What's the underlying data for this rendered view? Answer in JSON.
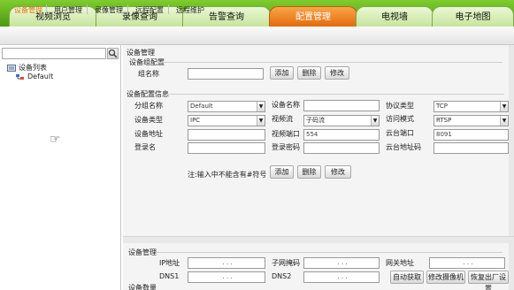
{
  "tabs": [
    {
      "label": "视频浏览"
    },
    {
      "label": "录像查询"
    },
    {
      "label": "告警查询"
    },
    {
      "label": "配置管理"
    },
    {
      "label": "电视墙"
    },
    {
      "label": "电子地图"
    }
  ],
  "submenu": [
    {
      "label": "设备管理"
    },
    {
      "label": "用户管理"
    },
    {
      "label": "录像管理"
    },
    {
      "label": "远程配置"
    },
    {
      "label": "远程维护"
    }
  ],
  "sidebar": {
    "tree_root": "设备列表",
    "tree_child": "Default"
  },
  "device_manage": {
    "title": "设备管理",
    "group_config": {
      "title": "设备组配置",
      "group_name_label": "组名称",
      "group_name_value": "",
      "add": "添加",
      "delete": "删除",
      "modify": "修改"
    },
    "config_info": {
      "title": "设备配置信息",
      "group_label": "分组名称",
      "group_value": "Default",
      "device_name_label": "设备名称",
      "device_name_value": "",
      "protocol_label": "协议类型",
      "protocol_value": "TCP",
      "device_type_label": "设备类型",
      "device_type_value": "IPC",
      "stream_label": "视频流",
      "stream_value": "子码流",
      "access_mode_label": "访问模式",
      "access_mode_value": "RTSP",
      "address_label": "设备地址",
      "address_value": "",
      "video_port_label": "视频端口",
      "video_port_value": "554",
      "ptz_port_label": "云台端口",
      "ptz_port_value": "8091",
      "login_name_label": "登录名",
      "login_name_value": "",
      "login_pwd_label": "登录密码",
      "login_pwd_value": "",
      "ptz_addr_label": "云台地址码",
      "ptz_addr_value": "",
      "note": "注:输入中不能含有#符号",
      "add": "添加",
      "delete": "删除",
      "modify": "修改"
    }
  },
  "bottom": {
    "title": "设备管理",
    "ip_label": "IP地址",
    "subnet_label": "子网掩码",
    "gateway_label": "网关地址",
    "dns1_label": "DNS1",
    "dns2_label": "DNS2",
    "ip_dots": ".   .   .",
    "auto_get": "自动获取",
    "modify_camera": "修改摄像机",
    "factory_reset": "恢复出厂设置",
    "device_count_label": "设备数量"
  },
  "colors": {
    "topbar": "#5aa91a",
    "active_tab": "#e8740f",
    "active_sub": "#e07418"
  }
}
